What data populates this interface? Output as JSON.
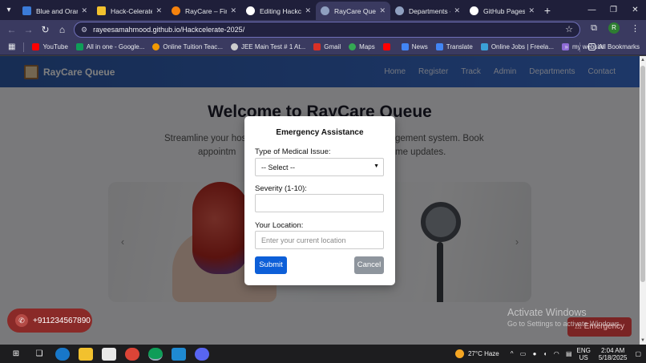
{
  "browser": {
    "tabs": [
      {
        "title": "Blue and Orange",
        "favicon_color": "#3b7bd8"
      },
      {
        "title": "Hack-Celerate P",
        "favicon_color": "#f2c12e"
      },
      {
        "title": "RayCare – Fireb",
        "favicon_color": "#f5820d"
      },
      {
        "title": "Editing Hackcel",
        "favicon_color": "#ffffff"
      },
      {
        "title": "RayCare Queue",
        "favicon_color": "#8fa0c0"
      },
      {
        "title": "Departments - R",
        "favicon_color": "#8fa0c0"
      },
      {
        "title": "GitHub Pages H",
        "favicon_color": "#ffffff"
      }
    ],
    "active_tab_index": 4,
    "url": "rayeesamahmood.github.io/Hackcelerate-2025/",
    "profile_initial": "R",
    "bookmarks": [
      {
        "label": "YouTube",
        "color": "#ff0000"
      },
      {
        "label": "All in one - Google...",
        "color": "#0f9d58"
      },
      {
        "label": "Online Tuition Teac...",
        "color": "#f29900"
      },
      {
        "label": "JEE Main Test # 1 At...",
        "color": "#cccccc"
      },
      {
        "label": "Gmail",
        "color": "#d93025"
      },
      {
        "label": "Maps",
        "color": "#34a853"
      },
      {
        "label": "",
        "color": "#ff0000"
      },
      {
        "label": "News",
        "color": "#4285f4"
      },
      {
        "label": "Translate",
        "color": "#4285f4"
      },
      {
        "label": "Online Jobs | Freela...",
        "color": "#3aa0d6"
      },
      {
        "label": "my website",
        "color": "#8e6bd6"
      }
    ],
    "all_bookmarks_label": "All Bookmarks"
  },
  "site": {
    "brand": "RayCare Queue",
    "nav": [
      "Home",
      "Register",
      "Track",
      "Admin",
      "Departments",
      "Contact"
    ],
    "hero_title": "Welcome to RayCare Queue",
    "hero_subtitle_left_1": "Streamline your hosp",
    "hero_subtitle_right_1": "gement system. Book",
    "hero_subtitle_left_2": "appointm",
    "hero_subtitle_right_2": "me updates."
  },
  "modal": {
    "title": "Emergency Assistance",
    "issue_label": "Type of Medical Issue:",
    "issue_selected": "-- Select --",
    "severity_label": "Severity (1-10):",
    "severity_value": "",
    "location_label": "Your Location:",
    "location_placeholder": "Enter your current location",
    "submit_label": "Submit",
    "cancel_label": "Cancel"
  },
  "floating": {
    "phone": "+911234567890",
    "emergency": "Emergency"
  },
  "watermark": {
    "line1": "Activate Windows",
    "line2": "Go to Settings to activate Windows."
  },
  "taskbar": {
    "weather_temp": "27°C",
    "weather_text": "Haze",
    "lang_1": "ENG",
    "lang_2": "US",
    "time": "2:04 AM",
    "date": "5/18/2025"
  }
}
